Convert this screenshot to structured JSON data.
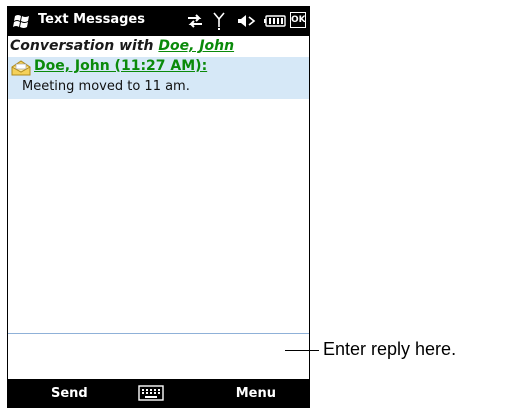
{
  "statusbar": {
    "app_title": "Text Messages",
    "icons": [
      "start-flag-icon",
      "data-sync-icon",
      "signal-icon",
      "speaker-muted-icon",
      "battery-icon",
      "ok-button-icon"
    ],
    "ok_label": "OK"
  },
  "conversation": {
    "header_prefix": "Conversation with ",
    "contact_name": "Doe, John"
  },
  "messages": [
    {
      "sender": "Doe, John (11:27 AM):",
      "body": "Meeting moved to 11 am.",
      "icon": "envelope-open-icon"
    }
  ],
  "reply": {
    "value": ""
  },
  "softkeys": {
    "left": "Send",
    "center_icon": "keyboard-icon",
    "right": "Menu"
  },
  "annotation": {
    "label": "Enter reply here."
  },
  "colors": {
    "bar_bg": "#000000",
    "link_green": "#0a8a0a",
    "message_highlight": "#d6e8f7",
    "reply_border": "#8fb1d8"
  }
}
